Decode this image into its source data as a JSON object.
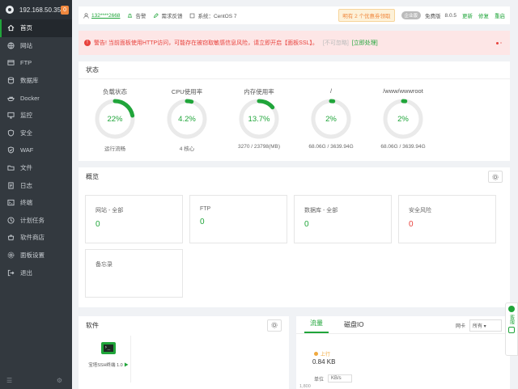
{
  "sidebar": {
    "ip": "192.168.50.35",
    "badge": "0",
    "items": [
      {
        "label": "首页",
        "icon": "home-icon"
      },
      {
        "label": "网站",
        "icon": "globe-icon"
      },
      {
        "label": "FTP",
        "icon": "ftp-icon"
      },
      {
        "label": "数据库",
        "icon": "database-icon"
      },
      {
        "label": "Docker",
        "icon": "docker-icon"
      },
      {
        "label": "监控",
        "icon": "monitor-icon"
      },
      {
        "label": "安全",
        "icon": "shield-icon"
      },
      {
        "label": "WAF",
        "icon": "firewall-icon"
      },
      {
        "label": "文件",
        "icon": "folder-icon"
      },
      {
        "label": "日志",
        "icon": "log-icon"
      },
      {
        "label": "终端",
        "icon": "terminal-icon"
      },
      {
        "label": "计划任务",
        "icon": "clock-icon"
      },
      {
        "label": "软件商店",
        "icon": "store-icon"
      },
      {
        "label": "面板设置",
        "icon": "settings-icon"
      },
      {
        "label": "退出",
        "icon": "logout-icon"
      }
    ]
  },
  "topbar": {
    "user": "132****2668",
    "alert": "告警",
    "feedback": "需求反馈",
    "system": "系统：CentOS 7",
    "promo": "明有 2 个优惠劵领取",
    "vip_badge": "企业版",
    "edition": "免费版",
    "version": "8.0.5",
    "update": "更新",
    "repair": "修复",
    "restart": "重启"
  },
  "warning": {
    "message": "警告! 当前面板使用HTTP访问，可能存在被窃取敏感信息风险，请立即开启【面板SSL】。",
    "ignore": "[不可忽略]",
    "action": "[立即处理]"
  },
  "status": {
    "title": "状态",
    "gauges": [
      {
        "title": "负载状态",
        "value": "22%",
        "percent": 22,
        "sub": "运行流畅"
      },
      {
        "title": "CPU使用率",
        "value": "4.2%",
        "percent": 4.2,
        "sub": "4 核心"
      },
      {
        "title": "内存使用率",
        "value": "13.7%",
        "percent": 13.7,
        "sub": "3270 / 23798(MB)"
      },
      {
        "title": "/",
        "value": "2%",
        "percent": 2,
        "sub": "68.06G / 3639.94G"
      },
      {
        "title": "/www/wwwroot",
        "value": "2%",
        "percent": 2,
        "sub": "68.06G / 3639.94G"
      }
    ]
  },
  "overview": {
    "title": "概览",
    "cards": [
      {
        "label": "网站 - 全部",
        "value": "0"
      },
      {
        "label": "FTP",
        "value": "0"
      },
      {
        "label": "数据库 - 全部",
        "value": "0"
      },
      {
        "label": "安全风险",
        "value": "0"
      },
      {
        "label": "备忘录",
        "value": ""
      }
    ]
  },
  "software": {
    "title": "软件",
    "tile": "宝塔SSH终端 1.0"
  },
  "traffic": {
    "tab_flow": "流量",
    "tab_disk": "磁盘IO",
    "nic_label": "网卡",
    "nic_value": "所有",
    "up_label": "上行",
    "up_value": "0.84 KB",
    "unit_label": "单位",
    "unit_value": "KB/s",
    "axis_top": "1,800"
  },
  "colors": {
    "accent": "#20a53a",
    "danger": "#e8413c",
    "warning_orange": "#f0883e",
    "sidebar_bg": "#33393f"
  }
}
